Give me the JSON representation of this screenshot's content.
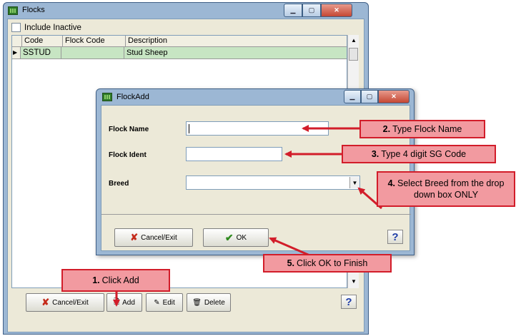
{
  "flocks_window": {
    "title": "Flocks",
    "include_inactive_label": "Include Inactive",
    "columns": [
      "Code",
      "Flock Code",
      "Description"
    ],
    "rows": [
      {
        "code": "SSTUD",
        "flock_code": "",
        "description": "Stud Sheep"
      }
    ],
    "buttons": {
      "cancel": "Cancel/Exit",
      "add": "Add",
      "edit": "Edit",
      "delete": "Delete"
    }
  },
  "flock_add_window": {
    "title": "FlockAdd",
    "fields": {
      "flock_name_label": "Flock Name",
      "flock_ident_label": "Flock Ident",
      "breed_label": "Breed"
    },
    "values": {
      "flock_name": "",
      "flock_ident": "",
      "breed": ""
    },
    "buttons": {
      "cancel": "Cancel/Exit",
      "ok": "OK"
    }
  },
  "callouts": {
    "step1": {
      "num": "1.",
      "text": "Click Add"
    },
    "step2": {
      "num": "2.",
      "text": "Type Flock Name"
    },
    "step3": {
      "num": "3.",
      "text": "Type 4 digit SG Code"
    },
    "step4": {
      "num": "4.",
      "text": "Select Breed from the drop down box ONLY"
    },
    "step5": {
      "num": "5.",
      "text": "Click OK to Finish"
    }
  },
  "colors": {
    "callout_fill": "#f29aa0",
    "callout_border": "#d21d2a",
    "selected_row": "#c7e5c3",
    "title_bar": "#9cb7d4"
  },
  "icons": [
    "flock-app-icon",
    "minimize-icon",
    "maximize-icon",
    "close-icon",
    "row-pointer-icon",
    "cancel-x-icon",
    "add-page-icon",
    "edit-icon",
    "delete-trash-icon",
    "help-icon",
    "ok-check-icon",
    "dropdown-arrow-icon"
  ]
}
